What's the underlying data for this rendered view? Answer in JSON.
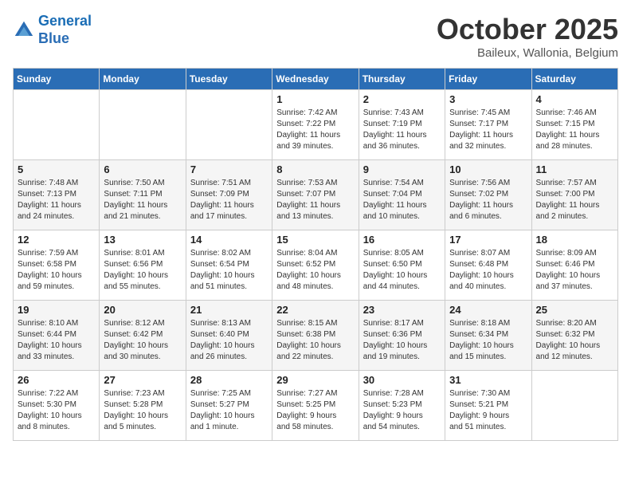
{
  "header": {
    "logo_line1": "General",
    "logo_line2": "Blue",
    "month": "October 2025",
    "location": "Baileux, Wallonia, Belgium"
  },
  "weekdays": [
    "Sunday",
    "Monday",
    "Tuesday",
    "Wednesday",
    "Thursday",
    "Friday",
    "Saturday"
  ],
  "weeks": [
    [
      {
        "day": "",
        "info": ""
      },
      {
        "day": "",
        "info": ""
      },
      {
        "day": "",
        "info": ""
      },
      {
        "day": "1",
        "info": "Sunrise: 7:42 AM\nSunset: 7:22 PM\nDaylight: 11 hours\nand 39 minutes."
      },
      {
        "day": "2",
        "info": "Sunrise: 7:43 AM\nSunset: 7:19 PM\nDaylight: 11 hours\nand 36 minutes."
      },
      {
        "day": "3",
        "info": "Sunrise: 7:45 AM\nSunset: 7:17 PM\nDaylight: 11 hours\nand 32 minutes."
      },
      {
        "day": "4",
        "info": "Sunrise: 7:46 AM\nSunset: 7:15 PM\nDaylight: 11 hours\nand 28 minutes."
      }
    ],
    [
      {
        "day": "5",
        "info": "Sunrise: 7:48 AM\nSunset: 7:13 PM\nDaylight: 11 hours\nand 24 minutes."
      },
      {
        "day": "6",
        "info": "Sunrise: 7:50 AM\nSunset: 7:11 PM\nDaylight: 11 hours\nand 21 minutes."
      },
      {
        "day": "7",
        "info": "Sunrise: 7:51 AM\nSunset: 7:09 PM\nDaylight: 11 hours\nand 17 minutes."
      },
      {
        "day": "8",
        "info": "Sunrise: 7:53 AM\nSunset: 7:07 PM\nDaylight: 11 hours\nand 13 minutes."
      },
      {
        "day": "9",
        "info": "Sunrise: 7:54 AM\nSunset: 7:04 PM\nDaylight: 11 hours\nand 10 minutes."
      },
      {
        "day": "10",
        "info": "Sunrise: 7:56 AM\nSunset: 7:02 PM\nDaylight: 11 hours\nand 6 minutes."
      },
      {
        "day": "11",
        "info": "Sunrise: 7:57 AM\nSunset: 7:00 PM\nDaylight: 11 hours\nand 2 minutes."
      }
    ],
    [
      {
        "day": "12",
        "info": "Sunrise: 7:59 AM\nSunset: 6:58 PM\nDaylight: 10 hours\nand 59 minutes."
      },
      {
        "day": "13",
        "info": "Sunrise: 8:01 AM\nSunset: 6:56 PM\nDaylight: 10 hours\nand 55 minutes."
      },
      {
        "day": "14",
        "info": "Sunrise: 8:02 AM\nSunset: 6:54 PM\nDaylight: 10 hours\nand 51 minutes."
      },
      {
        "day": "15",
        "info": "Sunrise: 8:04 AM\nSunset: 6:52 PM\nDaylight: 10 hours\nand 48 minutes."
      },
      {
        "day": "16",
        "info": "Sunrise: 8:05 AM\nSunset: 6:50 PM\nDaylight: 10 hours\nand 44 minutes."
      },
      {
        "day": "17",
        "info": "Sunrise: 8:07 AM\nSunset: 6:48 PM\nDaylight: 10 hours\nand 40 minutes."
      },
      {
        "day": "18",
        "info": "Sunrise: 8:09 AM\nSunset: 6:46 PM\nDaylight: 10 hours\nand 37 minutes."
      }
    ],
    [
      {
        "day": "19",
        "info": "Sunrise: 8:10 AM\nSunset: 6:44 PM\nDaylight: 10 hours\nand 33 minutes."
      },
      {
        "day": "20",
        "info": "Sunrise: 8:12 AM\nSunset: 6:42 PM\nDaylight: 10 hours\nand 30 minutes."
      },
      {
        "day": "21",
        "info": "Sunrise: 8:13 AM\nSunset: 6:40 PM\nDaylight: 10 hours\nand 26 minutes."
      },
      {
        "day": "22",
        "info": "Sunrise: 8:15 AM\nSunset: 6:38 PM\nDaylight: 10 hours\nand 22 minutes."
      },
      {
        "day": "23",
        "info": "Sunrise: 8:17 AM\nSunset: 6:36 PM\nDaylight: 10 hours\nand 19 minutes."
      },
      {
        "day": "24",
        "info": "Sunrise: 8:18 AM\nSunset: 6:34 PM\nDaylight: 10 hours\nand 15 minutes."
      },
      {
        "day": "25",
        "info": "Sunrise: 8:20 AM\nSunset: 6:32 PM\nDaylight: 10 hours\nand 12 minutes."
      }
    ],
    [
      {
        "day": "26",
        "info": "Sunrise: 7:22 AM\nSunset: 5:30 PM\nDaylight: 10 hours\nand 8 minutes."
      },
      {
        "day": "27",
        "info": "Sunrise: 7:23 AM\nSunset: 5:28 PM\nDaylight: 10 hours\nand 5 minutes."
      },
      {
        "day": "28",
        "info": "Sunrise: 7:25 AM\nSunset: 5:27 PM\nDaylight: 10 hours\nand 1 minute."
      },
      {
        "day": "29",
        "info": "Sunrise: 7:27 AM\nSunset: 5:25 PM\nDaylight: 9 hours\nand 58 minutes."
      },
      {
        "day": "30",
        "info": "Sunrise: 7:28 AM\nSunset: 5:23 PM\nDaylight: 9 hours\nand 54 minutes."
      },
      {
        "day": "31",
        "info": "Sunrise: 7:30 AM\nSunset: 5:21 PM\nDaylight: 9 hours\nand 51 minutes."
      },
      {
        "day": "",
        "info": ""
      }
    ]
  ]
}
